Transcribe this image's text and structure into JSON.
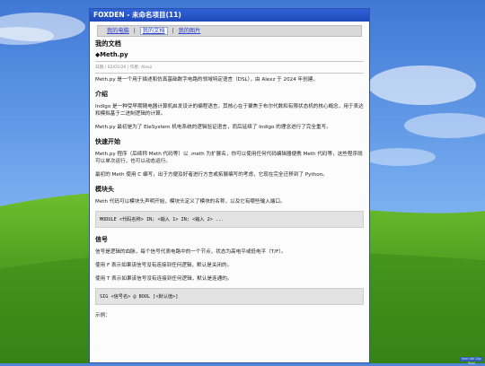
{
  "window": {
    "title": "FOXDEN - 未命名项目(11)"
  },
  "nav": {
    "items": [
      {
        "label": "我的电脑"
      },
      {
        "label": "我的文档"
      },
      {
        "label": "我的图片"
      }
    ],
    "active_index": 1,
    "separator": "|"
  },
  "doc": {
    "section_title": "我的文档",
    "file_title": "◆Meth.py",
    "meta": "日期 / 02/01/26 | 作者: Alexz",
    "intro": "Meth.py 是一个用于描述和仿真基础数字电路的领域特定语言（DSL），由 Alexz 于 2024 年创建。",
    "s_intro_h": "介绍",
    "intro_p1": "Indigo 是一种受早期随电器计算机启发设计的编程语言，其核心在于聚焦于布尔代数和有限状态机的核心概念，用于表达和模拟基于二进制逻辑的计算。",
    "intro_p2": "Meth.py 最初是为了 EleSystem 机电系统的逻辑验证语言，而后延续了 Indigo 的理念进行了完全重写。",
    "s_quick_h": "快速开始",
    "quick_p1": "Meth.py 程序（后续称 Meth 代码等）以 .meth 为扩展名，你可以使用任何代码编辑器便携 Meth 代码等，这些程序既可以单次运行，也可以动态运行。",
    "quick_p2": "最初的 Meth 使用 C 编写，出于方便及好者进行方言或拓展编写的考虑，它现在完全迁移到了 Python。",
    "s_module_h": "模块头",
    "module_p": "Meth 代码可以模块头声明开始，模块头定义了模块的名称，以及它有哪些输入端口。",
    "module_code": "MODULE <代码名称> IN; <输入 1> IN; <输入 2> ...",
    "s_signal_h": "信号",
    "signal_p1": "信号是逻辑的血脉，每个信号代表电路中的一个节点，状态为高电平或低电平（T/F）。",
    "signal_p2": "使用 F 表示如果该信号没有连接到任何逻辑，默认是关闭的。",
    "signal_p3": "使用 T 表示如果该信号没有连接到任何逻辑，默认是连通的。",
    "signal_code": "SIG <信号名> @ BOOL [<默认值>]",
    "example_label": "示例："
  },
  "taskbar": {
    "badge": "Intel 4th Day Prod"
  }
}
